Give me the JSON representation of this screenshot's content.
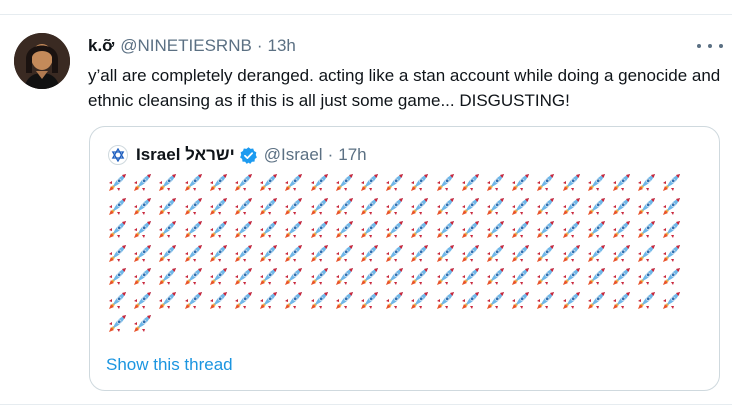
{
  "tweet": {
    "display_name": "k.ỡ",
    "handle": "@NINETIESRNB",
    "separator": "·",
    "time": "13h",
    "text": "y’all are completely deranged. acting like a stan account while doing a genocide and ethnic cleansing as if this is all just some game... DISGUSTING!"
  },
  "quoted_tweet": {
    "display_name": "Israel ישראל",
    "handle": "@Israel",
    "separator": "·",
    "time": "17h",
    "verified": true,
    "rocket_rows": [
      23,
      23,
      23,
      23,
      23,
      23,
      2
    ],
    "rocket_emoji": "🚀",
    "show_thread_label": "Show this thread"
  },
  "colors": {
    "link": "#1b95e0",
    "secondary_text": "#5b7083",
    "border": "#cfd9de",
    "verified": "#1d9bf0"
  },
  "icons": {
    "more": "more-dots-icon",
    "verified": "verified-badge-icon",
    "quoted_avatar": "star-of-david-icon"
  }
}
